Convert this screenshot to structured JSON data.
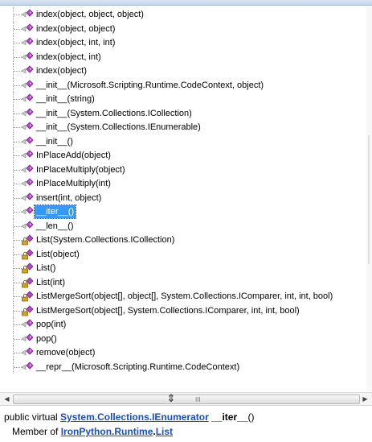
{
  "tree": {
    "items": [
      {
        "label": "index(object, object, object)",
        "icon": "method-icon",
        "selected": false
      },
      {
        "label": "index(object, object)",
        "icon": "method-icon",
        "selected": false
      },
      {
        "label": "index(object, int, int)",
        "icon": "method-icon",
        "selected": false
      },
      {
        "label": "index(object, int)",
        "icon": "method-icon",
        "selected": false
      },
      {
        "label": "index(object)",
        "icon": "method-icon",
        "selected": false
      },
      {
        "label": "__init__(Microsoft.Scripting.Runtime.CodeContext, object)",
        "icon": "method-icon",
        "selected": false
      },
      {
        "label": "__init__(string)",
        "icon": "method-icon",
        "selected": false
      },
      {
        "label": "__init__(System.Collections.ICollection)",
        "icon": "method-icon",
        "selected": false
      },
      {
        "label": "__init__(System.Collections.IEnumerable)",
        "icon": "method-icon",
        "selected": false
      },
      {
        "label": "__init__()",
        "icon": "method-icon",
        "selected": false
      },
      {
        "label": "InPlaceAdd(object)",
        "icon": "method-icon",
        "selected": false
      },
      {
        "label": "InPlaceMultiply(object)",
        "icon": "method-icon",
        "selected": false
      },
      {
        "label": "InPlaceMultiply(int)",
        "icon": "method-icon",
        "selected": false
      },
      {
        "label": "insert(int, object)",
        "icon": "method-icon",
        "selected": false
      },
      {
        "label": "__iter__()",
        "icon": "method-icon",
        "selected": true
      },
      {
        "label": "__len__()",
        "icon": "method-icon",
        "selected": false
      },
      {
        "label": "List(System.Collections.ICollection)",
        "icon": "constructor-lock-icon",
        "selected": false
      },
      {
        "label": "List(object)",
        "icon": "constructor-lock-icon",
        "selected": false
      },
      {
        "label": "List()",
        "icon": "constructor-lock-icon",
        "selected": false
      },
      {
        "label": "List(int)",
        "icon": "constructor-lock-icon",
        "selected": false
      },
      {
        "label": "ListMergeSort(object[], object[], System.Collections.IComparer, int, int, bool)",
        "icon": "constructor-lock-icon",
        "selected": false
      },
      {
        "label": "ListMergeSort(object[], System.Collections.IComparer, int, int, bool)",
        "icon": "constructor-lock-icon",
        "selected": false
      },
      {
        "label": "pop(int)",
        "icon": "method-icon",
        "selected": false
      },
      {
        "label": "pop()",
        "icon": "method-icon",
        "selected": false
      },
      {
        "label": "remove(object)",
        "icon": "method-icon",
        "selected": false
      },
      {
        "label": "__repr__(Microsoft.Scripting.Runtime.CodeContext)",
        "icon": "method-icon",
        "selected": false
      }
    ]
  },
  "scrollbar": {
    "left_arrow": "◀",
    "right_arrow": "▶",
    "grip": "III"
  },
  "splitter": {
    "glyph": "⇕"
  },
  "description": {
    "prefix": "public virtual",
    "return_type": "System.Collections.IEnumerator",
    "member_name": "__iter__",
    "suffix": "()",
    "member_of_label": "Member of",
    "namespace": "IronPython.Runtime",
    "separator": ".",
    "class_name": "List"
  },
  "colors": {
    "method_icon": "#b347c8",
    "lock_icon": "#d6a21c",
    "selection": "#3399ff",
    "link": "#1a4ebd"
  }
}
